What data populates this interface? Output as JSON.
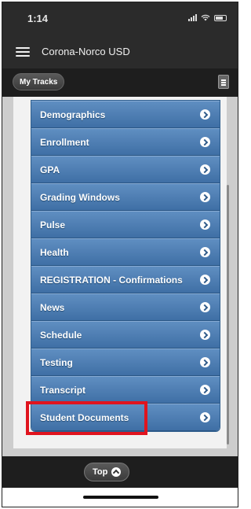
{
  "status_bar": {
    "time": "1:14"
  },
  "app_bar": {
    "title": "Corona-Norco USD"
  },
  "toolbar": {
    "my_tracks_label": "My Tracks"
  },
  "menu": {
    "items": [
      {
        "label": "Demographics"
      },
      {
        "label": "Enrollment"
      },
      {
        "label": "GPA"
      },
      {
        "label": "Grading Windows"
      },
      {
        "label": "Pulse"
      },
      {
        "label": "Health"
      },
      {
        "label": "REGISTRATION - Confirmations"
      },
      {
        "label": "News"
      },
      {
        "label": "Schedule"
      },
      {
        "label": "Testing"
      },
      {
        "label": "Transcript"
      },
      {
        "label": "Student Documents"
      }
    ],
    "highlighted_item": "Student Documents",
    "highlight_color": "#e0141e",
    "item_color": "#4a7ab2"
  },
  "footer": {
    "top_label": "Top"
  },
  "icons": {
    "menu": "hamburger-icon",
    "overflow": "list-menu-icon",
    "item_chevron": "chevron-right-circle-icon",
    "top": "chevron-up-circle-icon"
  }
}
